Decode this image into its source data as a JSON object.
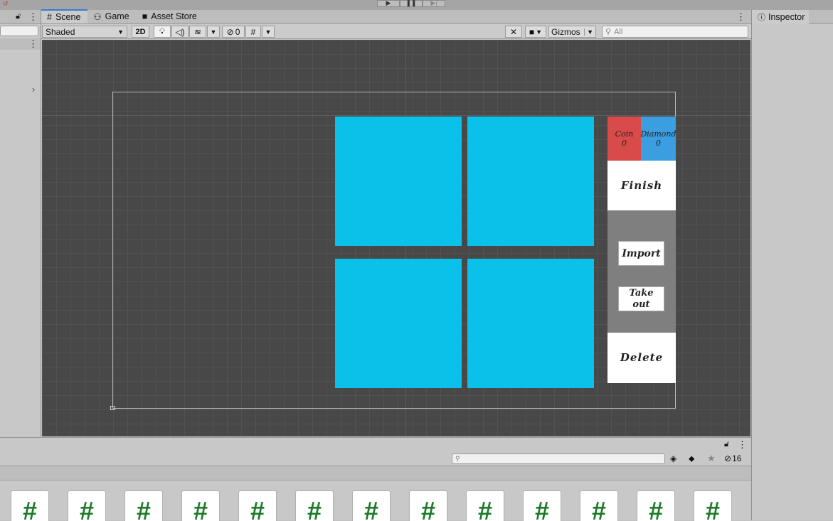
{
  "scene_tabs": [
    {
      "label": "Scene",
      "icon": "grid-icon",
      "active": true
    },
    {
      "label": "Game",
      "icon": "gamepad-icon",
      "active": false
    },
    {
      "label": "Asset Store",
      "icon": "bag-icon",
      "active": false
    }
  ],
  "toolbar": {
    "draw_mode": "Shaded",
    "mode_2d": "2D",
    "hidden_count": "0",
    "gizmos": "Gizmos",
    "search_placeholder": "All"
  },
  "inspector": {
    "tab_label": "Inspector"
  },
  "game_ui": {
    "coin_label": "Coin",
    "coin_value": "0",
    "diamond_label": "Diamond",
    "diamond_value": "0",
    "finish": "Finish",
    "import": "Import",
    "take_out": "Take out",
    "delete": "Delete",
    "colors": {
      "tile": "#09c1e9",
      "coin": "#d94a4a",
      "diamond": "#3a9ee0"
    }
  },
  "project": {
    "hidden_count": "16",
    "file_icon_glyph": "#",
    "file_count": 13
  }
}
